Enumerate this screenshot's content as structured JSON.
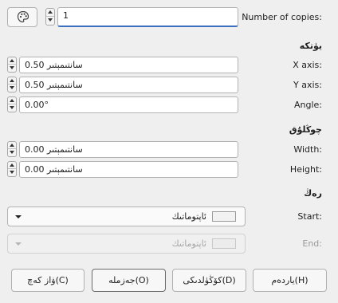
{
  "copies": {
    "label": "Number of copies:",
    "value": "1"
  },
  "line": {
    "heading": "يۈتكە",
    "x_axis": {
      "label": "X axis:",
      "value": "0.50 سانتىمېتىر"
    },
    "y_axis": {
      "label": "Y axis:",
      "value": "0.50 سانتىمېتىر"
    },
    "angle": {
      "label": "Angle:",
      "value": "0.00°"
    }
  },
  "size": {
    "heading": "چوڭلۇق",
    "width": {
      "label": "Width:",
      "value": "0.00 سانتىمېتىر"
    },
    "height": {
      "label": "Height:",
      "value": "0.00 سانتىمېتىر"
    }
  },
  "color": {
    "heading": "رەڭ",
    "start": {
      "label": "Start:",
      "value": "ئاپتوماتىك"
    },
    "end": {
      "label": "End:",
      "value": "ئاپتوماتىك"
    }
  },
  "buttons": {
    "help": "ياردەم(H)",
    "reset": "كۆڭۈلدىكى(D)",
    "ok": "جەزملە(O)",
    "cancel": "ۋاز كەچ(C)"
  },
  "icons": {
    "palette": "palette-icon"
  }
}
